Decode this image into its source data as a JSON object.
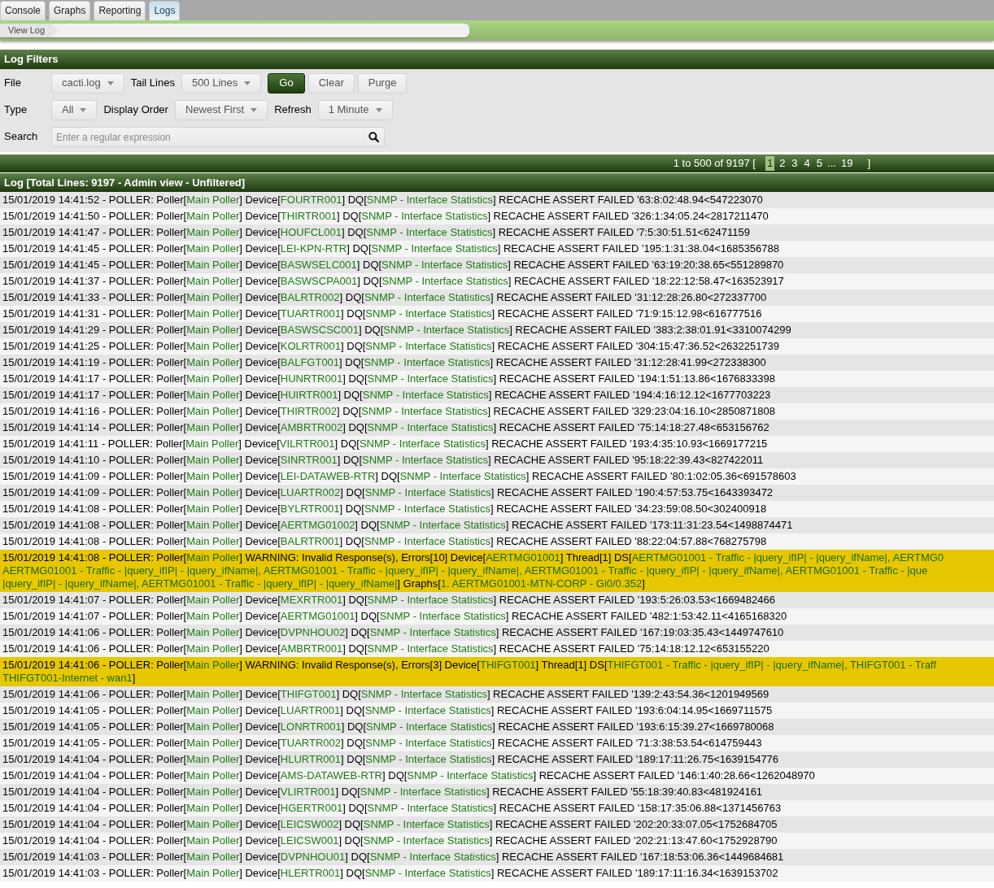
{
  "tabs": [
    {
      "label": "Console",
      "selected": false
    },
    {
      "label": "Graphs",
      "selected": false
    },
    {
      "label": "Reporting",
      "selected": false
    },
    {
      "label": "Logs",
      "selected": true
    }
  ],
  "breadcrumb": [
    "View Log"
  ],
  "filters": {
    "title": "Log Filters",
    "rows": [
      {
        "controls": [
          {
            "kind": "label",
            "text": "File"
          },
          {
            "kind": "select",
            "value": "cacti.log"
          },
          {
            "kind": "label",
            "text": "Tail Lines"
          },
          {
            "kind": "select",
            "value": "500 Lines"
          },
          {
            "kind": "primary_button",
            "text": "Go"
          },
          {
            "kind": "button",
            "text": "Clear"
          },
          {
            "kind": "button",
            "text": "Purge"
          }
        ]
      },
      {
        "controls": [
          {
            "kind": "label",
            "text": "Type"
          },
          {
            "kind": "select",
            "value": "All"
          },
          {
            "kind": "label",
            "text": "Display Order"
          },
          {
            "kind": "select",
            "value": "Newest First"
          },
          {
            "kind": "label",
            "text": "Refresh"
          },
          {
            "kind": "select",
            "value": "1 Minute"
          }
        ]
      },
      {
        "controls": [
          {
            "kind": "label",
            "text": "Search"
          },
          {
            "kind": "search",
            "placeholder": "Enter a regular expression"
          }
        ]
      }
    ]
  },
  "pagination": {
    "summary": "1 to 500 of 9197 [",
    "pages": [
      {
        "label": "1",
        "selected": true
      },
      {
        "label": "2",
        "selected": false
      },
      {
        "label": "3",
        "selected": false
      },
      {
        "label": "4",
        "selected": false
      },
      {
        "label": "5",
        "selected": false
      }
    ],
    "ellipsis": "...",
    "last_pages": [
      {
        "label": "19",
        "selected": false
      }
    ],
    "closing": "]"
  },
  "log": {
    "title": "Log [Total Lines: 9197 - Admin view - Unfiltered]",
    "rows": [
      {
        "kind": "info",
        "lines": [
          [
            {
              "text": "15/01/2019 14:41:52 - POLLER: Poller[",
              "highlighted": false
            },
            {
              "text": "Main Poller",
              "highlighted": true
            },
            {
              "text": "] Device[",
              "highlighted": false
            },
            {
              "text": "FOURTR001",
              "highlighted": true
            },
            {
              "text": "] DQ[",
              "highlighted": false
            },
            {
              "text": "SNMP - Interface Statistics",
              "highlighted": true
            },
            {
              "text": "] RECACHE ASSERT FAILED '63:8:02:48.94<547223070",
              "highlighted": false
            }
          ]
        ]
      },
      {
        "kind": "info",
        "lines": [
          [
            {
              "text": "15/01/2019 14:41:50 - POLLER: Poller[",
              "highlighted": false
            },
            {
              "text": "Main Poller",
              "highlighted": true
            },
            {
              "text": "] Device[",
              "highlighted": false
            },
            {
              "text": "THIRTR001",
              "highlighted": true
            },
            {
              "text": "] DQ[",
              "highlighted": false
            },
            {
              "text": "SNMP - Interface Statistics",
              "highlighted": true
            },
            {
              "text": "] RECACHE ASSERT FAILED '326:1:34:05.24<2817211470",
              "highlighted": false
            }
          ]
        ]
      },
      {
        "kind": "info",
        "lines": [
          [
            {
              "text": "15/01/2019 14:41:47 - POLLER: Poller[",
              "highlighted": false
            },
            {
              "text": "Main Poller",
              "highlighted": true
            },
            {
              "text": "] Device[",
              "highlighted": false
            },
            {
              "text": "HOUFCL001",
              "highlighted": true
            },
            {
              "text": "] DQ[",
              "highlighted": false
            },
            {
              "text": "SNMP - Interface Statistics",
              "highlighted": true
            },
            {
              "text": "] RECACHE ASSERT FAILED '7:5:30:51.51<62471159",
              "highlighted": false
            }
          ]
        ]
      },
      {
        "kind": "info",
        "lines": [
          [
            {
              "text": "15/01/2019 14:41:45 - POLLER: Poller[",
              "highlighted": false
            },
            {
              "text": "Main Poller",
              "highlighted": true
            },
            {
              "text": "] Device[",
              "highlighted": false
            },
            {
              "text": "LEI-KPN-RTR",
              "highlighted": true
            },
            {
              "text": "] DQ[",
              "highlighted": false
            },
            {
              "text": "SNMP - Interface Statistics",
              "highlighted": true
            },
            {
              "text": "] RECACHE ASSERT FAILED '195:1:31:38.04<1685356788",
              "highlighted": false
            }
          ]
        ]
      },
      {
        "kind": "info",
        "lines": [
          [
            {
              "text": "15/01/2019 14:41:45 - POLLER: Poller[",
              "highlighted": false
            },
            {
              "text": "Main Poller",
              "highlighted": true
            },
            {
              "text": "] Device[",
              "highlighted": false
            },
            {
              "text": "BASWSELC001",
              "highlighted": true
            },
            {
              "text": "] DQ[",
              "highlighted": false
            },
            {
              "text": "SNMP - Interface Statistics",
              "highlighted": true
            },
            {
              "text": "] RECACHE ASSERT FAILED '63:19:20:38.65<551289870",
              "highlighted": false
            }
          ]
        ]
      },
      {
        "kind": "info",
        "lines": [
          [
            {
              "text": "15/01/2019 14:41:37 - POLLER: Poller[",
              "highlighted": false
            },
            {
              "text": "Main Poller",
              "highlighted": true
            },
            {
              "text": "] Device[",
              "highlighted": false
            },
            {
              "text": "BASWSCPA001",
              "highlighted": true
            },
            {
              "text": "] DQ[",
              "highlighted": false
            },
            {
              "text": "SNMP - Interface Statistics",
              "highlighted": true
            },
            {
              "text": "] RECACHE ASSERT FAILED '18:22:12:58.47<163523917",
              "highlighted": false
            }
          ]
        ]
      },
      {
        "kind": "info",
        "lines": [
          [
            {
              "text": "15/01/2019 14:41:33 - POLLER: Poller[",
              "highlighted": false
            },
            {
              "text": "Main Poller",
              "highlighted": true
            },
            {
              "text": "] Device[",
              "highlighted": false
            },
            {
              "text": "BALRTR002",
              "highlighted": true
            },
            {
              "text": "] DQ[",
              "highlighted": false
            },
            {
              "text": "SNMP - Interface Statistics",
              "highlighted": true
            },
            {
              "text": "] RECACHE ASSERT FAILED '31:12:28:26.80<272337700",
              "highlighted": false
            }
          ]
        ]
      },
      {
        "kind": "info",
        "lines": [
          [
            {
              "text": "15/01/2019 14:41:31 - POLLER: Poller[",
              "highlighted": false
            },
            {
              "text": "Main Poller",
              "highlighted": true
            },
            {
              "text": "] Device[",
              "highlighted": false
            },
            {
              "text": "TUARTR001",
              "highlighted": true
            },
            {
              "text": "] DQ[",
              "highlighted": false
            },
            {
              "text": "SNMP - Interface Statistics",
              "highlighted": true
            },
            {
              "text": "] RECACHE ASSERT FAILED '71:9:15:12.98<616777516",
              "highlighted": false
            }
          ]
        ]
      },
      {
        "kind": "info",
        "lines": [
          [
            {
              "text": "15/01/2019 14:41:29 - POLLER: Poller[",
              "highlighted": false
            },
            {
              "text": "Main Poller",
              "highlighted": true
            },
            {
              "text": "] Device[",
              "highlighted": false
            },
            {
              "text": "BASWSCSC001",
              "highlighted": true
            },
            {
              "text": "] DQ[",
              "highlighted": false
            },
            {
              "text": "SNMP - Interface Statistics",
              "highlighted": true
            },
            {
              "text": "] RECACHE ASSERT FAILED '383:2:38:01.91<3310074299",
              "highlighted": false
            }
          ]
        ]
      },
      {
        "kind": "info",
        "lines": [
          [
            {
              "text": "15/01/2019 14:41:25 - POLLER: Poller[",
              "highlighted": false
            },
            {
              "text": "Main Poller",
              "highlighted": true
            },
            {
              "text": "] Device[",
              "highlighted": false
            },
            {
              "text": "KOLRTR001",
              "highlighted": true
            },
            {
              "text": "] DQ[",
              "highlighted": false
            },
            {
              "text": "SNMP - Interface Statistics",
              "highlighted": true
            },
            {
              "text": "] RECACHE ASSERT FAILED '304:15:47:36.52<2632251739",
              "highlighted": false
            }
          ]
        ]
      },
      {
        "kind": "info",
        "lines": [
          [
            {
              "text": "15/01/2019 14:41:19 - POLLER: Poller[",
              "highlighted": false
            },
            {
              "text": "Main Poller",
              "highlighted": true
            },
            {
              "text": "] Device[",
              "highlighted": false
            },
            {
              "text": "BALFGT001",
              "highlighted": true
            },
            {
              "text": "] DQ[",
              "highlighted": false
            },
            {
              "text": "SNMP - Interface Statistics",
              "highlighted": true
            },
            {
              "text": "] RECACHE ASSERT FAILED '31:12:28:41.99<272338300",
              "highlighted": false
            }
          ]
        ]
      },
      {
        "kind": "info",
        "lines": [
          [
            {
              "text": "15/01/2019 14:41:17 - POLLER: Poller[",
              "highlighted": false
            },
            {
              "text": "Main Poller",
              "highlighted": true
            },
            {
              "text": "] Device[",
              "highlighted": false
            },
            {
              "text": "HUNRTR001",
              "highlighted": true
            },
            {
              "text": "] DQ[",
              "highlighted": false
            },
            {
              "text": "SNMP - Interface Statistics",
              "highlighted": true
            },
            {
              "text": "] RECACHE ASSERT FAILED '194:1:51:13.86<1676833398",
              "highlighted": false
            }
          ]
        ]
      },
      {
        "kind": "info",
        "lines": [
          [
            {
              "text": "15/01/2019 14:41:17 - POLLER: Poller[",
              "highlighted": false
            },
            {
              "text": "Main Poller",
              "highlighted": true
            },
            {
              "text": "] Device[",
              "highlighted": false
            },
            {
              "text": "HUIRTR001",
              "highlighted": true
            },
            {
              "text": "] DQ[",
              "highlighted": false
            },
            {
              "text": "SNMP - Interface Statistics",
              "highlighted": true
            },
            {
              "text": "] RECACHE ASSERT FAILED '194:4:16:12.12<1677703223",
              "highlighted": false
            }
          ]
        ]
      },
      {
        "kind": "info",
        "lines": [
          [
            {
              "text": "15/01/2019 14:41:16 - POLLER: Poller[",
              "highlighted": false
            },
            {
              "text": "Main Poller",
              "highlighted": true
            },
            {
              "text": "] Device[",
              "highlighted": false
            },
            {
              "text": "THIRTR002",
              "highlighted": true
            },
            {
              "text": "] DQ[",
              "highlighted": false
            },
            {
              "text": "SNMP - Interface Statistics",
              "highlighted": true
            },
            {
              "text": "] RECACHE ASSERT FAILED '329:23:04:16.10<2850871808",
              "highlighted": false
            }
          ]
        ]
      },
      {
        "kind": "info",
        "lines": [
          [
            {
              "text": "15/01/2019 14:41:14 - POLLER: Poller[",
              "highlighted": false
            },
            {
              "text": "Main Poller",
              "highlighted": true
            },
            {
              "text": "] Device[",
              "highlighted": false
            },
            {
              "text": "AMBRTR002",
              "highlighted": true
            },
            {
              "text": "] DQ[",
              "highlighted": false
            },
            {
              "text": "SNMP - Interface Statistics",
              "highlighted": true
            },
            {
              "text": "] RECACHE ASSERT FAILED '75:14:18:27.48<653156762",
              "highlighted": false
            }
          ]
        ]
      },
      {
        "kind": "info",
        "lines": [
          [
            {
              "text": "15/01/2019 14:41:11 - POLLER: Poller[",
              "highlighted": false
            },
            {
              "text": "Main Poller",
              "highlighted": true
            },
            {
              "text": "] Device[",
              "highlighted": false
            },
            {
              "text": "VILRTR001",
              "highlighted": true
            },
            {
              "text": "] DQ[",
              "highlighted": false
            },
            {
              "text": "SNMP - Interface Statistics",
              "highlighted": true
            },
            {
              "text": "] RECACHE ASSERT FAILED '193:4:35:10.93<1669177215",
              "highlighted": false
            }
          ]
        ]
      },
      {
        "kind": "info",
        "lines": [
          [
            {
              "text": "15/01/2019 14:41:10 - POLLER: Poller[",
              "highlighted": false
            },
            {
              "text": "Main Poller",
              "highlighted": true
            },
            {
              "text": "] Device[",
              "highlighted": false
            },
            {
              "text": "SINRTR001",
              "highlighted": true
            },
            {
              "text": "] DQ[",
              "highlighted": false
            },
            {
              "text": "SNMP - Interface Statistics",
              "highlighted": true
            },
            {
              "text": "] RECACHE ASSERT FAILED '95:18:22:39.43<827422011",
              "highlighted": false
            }
          ]
        ]
      },
      {
        "kind": "info",
        "lines": [
          [
            {
              "text": "15/01/2019 14:41:09 - POLLER: Poller[",
              "highlighted": false
            },
            {
              "text": "Main Poller",
              "highlighted": true
            },
            {
              "text": "] Device[",
              "highlighted": false
            },
            {
              "text": "LEI-DATAWEB-RTR",
              "highlighted": true
            },
            {
              "text": "] DQ[",
              "highlighted": false
            },
            {
              "text": "SNMP - Interface Statistics",
              "highlighted": true
            },
            {
              "text": "] RECACHE ASSERT FAILED '80:1:02:05.36<691578603",
              "highlighted": false
            }
          ]
        ]
      },
      {
        "kind": "info",
        "lines": [
          [
            {
              "text": "15/01/2019 14:41:09 - POLLER: Poller[",
              "highlighted": false
            },
            {
              "text": "Main Poller",
              "highlighted": true
            },
            {
              "text": "] Device[",
              "highlighted": false
            },
            {
              "text": "LUARTR002",
              "highlighted": true
            },
            {
              "text": "] DQ[",
              "highlighted": false
            },
            {
              "text": "SNMP - Interface Statistics",
              "highlighted": true
            },
            {
              "text": "] RECACHE ASSERT FAILED '190:4:57:53.75<1643393472",
              "highlighted": false
            }
          ]
        ]
      },
      {
        "kind": "info",
        "lines": [
          [
            {
              "text": "15/01/2019 14:41:08 - POLLER: Poller[",
              "highlighted": false
            },
            {
              "text": "Main Poller",
              "highlighted": true
            },
            {
              "text": "] Device[",
              "highlighted": false
            },
            {
              "text": "BYLRTR001",
              "highlighted": true
            },
            {
              "text": "] DQ[",
              "highlighted": false
            },
            {
              "text": "SNMP - Interface Statistics",
              "highlighted": true
            },
            {
              "text": "] RECACHE ASSERT FAILED '34:23:59:08.50<302400918",
              "highlighted": false
            }
          ]
        ]
      },
      {
        "kind": "info",
        "lines": [
          [
            {
              "text": "15/01/2019 14:41:08 - POLLER: Poller[",
              "highlighted": false
            },
            {
              "text": "Main Poller",
              "highlighted": true
            },
            {
              "text": "] Device[",
              "highlighted": false
            },
            {
              "text": "AERTMG01002",
              "highlighted": true
            },
            {
              "text": "] DQ[",
              "highlighted": false
            },
            {
              "text": "SNMP - Interface Statistics",
              "highlighted": true
            },
            {
              "text": "] RECACHE ASSERT FAILED '173:11:31:23.54<1498874471",
              "highlighted": false
            }
          ]
        ]
      },
      {
        "kind": "info",
        "lines": [
          [
            {
              "text": "15/01/2019 14:41:08 - POLLER: Poller[",
              "highlighted": false
            },
            {
              "text": "Main Poller",
              "highlighted": true
            },
            {
              "text": "] Device[",
              "highlighted": false
            },
            {
              "text": "BALRTR001",
              "highlighted": true
            },
            {
              "text": "] DQ[",
              "highlighted": false
            },
            {
              "text": "SNMP - Interface Statistics",
              "highlighted": true
            },
            {
              "text": "] RECACHE ASSERT FAILED '88:22:04:57.88<768275798",
              "highlighted": false
            }
          ]
        ]
      },
      {
        "kind": "warning",
        "lines": [
          [
            {
              "text": "15/01/2019 14:41:08 - POLLER: Poller[",
              "highlighted": false
            },
            {
              "text": "Main Poller",
              "highlighted": true
            },
            {
              "text": "] WARNING: Invalid Response(s), Errors[10] Device[",
              "highlighted": false
            },
            {
              "text": "AERTMG01001",
              "highlighted": true
            },
            {
              "text": "] Thread[1] DS[",
              "highlighted": false
            },
            {
              "text": "AERTMG01001 - Traffic - |query_ifIP| - |query_ifName|, AERTMG0",
              "highlighted": true
            }
          ],
          [
            {
              "text": "AERTMG01001 - Traffic - |query_ifIP| - |query_ifName|, AERTMG01001 - Traffic - |query_ifIP| - |query_ifName|, AERTMG01001 - Traffic - |query_ifIP| - |query_ifName|, AERTMG01001 - Traffic - |que",
              "highlighted": true
            }
          ],
          [
            {
              "text": "|query_ifIP| - |query_ifName|, AERTMG01001 - Traffic - |query_ifIP| - |query_ifName|",
              "highlighted": true
            },
            {
              "text": "] Graphs[",
              "highlighted": false
            },
            {
              "text": "1. AERTMG01001-MTN-CORP - Gi0/0.352",
              "highlighted": true
            },
            {
              "text": "]",
              "highlighted": false
            }
          ]
        ]
      },
      {
        "kind": "info",
        "lines": [
          [
            {
              "text": "15/01/2019 14:41:07 - POLLER: Poller[",
              "highlighted": false
            },
            {
              "text": "Main Poller",
              "highlighted": true
            },
            {
              "text": "] Device[",
              "highlighted": false
            },
            {
              "text": "MEXRTR001",
              "highlighted": true
            },
            {
              "text": "] DQ[",
              "highlighted": false
            },
            {
              "text": "SNMP - Interface Statistics",
              "highlighted": true
            },
            {
              "text": "] RECACHE ASSERT FAILED '193:5:26:03.53<1669482466",
              "highlighted": false
            }
          ]
        ]
      },
      {
        "kind": "info",
        "lines": [
          [
            {
              "text": "15/01/2019 14:41:07 - POLLER: Poller[",
              "highlighted": false
            },
            {
              "text": "Main Poller",
              "highlighted": true
            },
            {
              "text": "] Device[",
              "highlighted": false
            },
            {
              "text": "AERTMG01001",
              "highlighted": true
            },
            {
              "text": "] DQ[",
              "highlighted": false
            },
            {
              "text": "SNMP - Interface Statistics",
              "highlighted": true
            },
            {
              "text": "] RECACHE ASSERT FAILED '482:1:53:42.11<4165168320",
              "highlighted": false
            }
          ]
        ]
      },
      {
        "kind": "info",
        "lines": [
          [
            {
              "text": "15/01/2019 14:41:06 - POLLER: Poller[",
              "highlighted": false
            },
            {
              "text": "Main Poller",
              "highlighted": true
            },
            {
              "text": "] Device[",
              "highlighted": false
            },
            {
              "text": "DVPNHOU02",
              "highlighted": true
            },
            {
              "text": "] DQ[",
              "highlighted": false
            },
            {
              "text": "SNMP - Interface Statistics",
              "highlighted": true
            },
            {
              "text": "] RECACHE ASSERT FAILED '167:19:03:35.43<1449747610",
              "highlighted": false
            }
          ]
        ]
      },
      {
        "kind": "info",
        "lines": [
          [
            {
              "text": "15/01/2019 14:41:06 - POLLER: Poller[",
              "highlighted": false
            },
            {
              "text": "Main Poller",
              "highlighted": true
            },
            {
              "text": "] Device[",
              "highlighted": false
            },
            {
              "text": "AMBRTR001",
              "highlighted": true
            },
            {
              "text": "] DQ[",
              "highlighted": false
            },
            {
              "text": "SNMP - Interface Statistics",
              "highlighted": true
            },
            {
              "text": "] RECACHE ASSERT FAILED '75:14:18:12.12<653155220",
              "highlighted": false
            }
          ]
        ]
      },
      {
        "kind": "warning",
        "lines": [
          [
            {
              "text": "15/01/2019 14:41:06 - POLLER: Poller[",
              "highlighted": false
            },
            {
              "text": "Main Poller",
              "highlighted": true
            },
            {
              "text": "] WARNING: Invalid Response(s), Errors[3] Device[",
              "highlighted": false
            },
            {
              "text": "THIFGT001",
              "highlighted": true
            },
            {
              "text": "] Thread[1] DS[",
              "highlighted": false
            },
            {
              "text": "THIFGT001 - Traffic - |query_ifIP| - |query_ifName|, THIFGT001 - Traff",
              "highlighted": true
            }
          ],
          [
            {
              "text": "THIFGT001-Internet - wan1",
              "highlighted": true
            },
            {
              "text": "]",
              "highlighted": false
            }
          ]
        ]
      },
      {
        "kind": "info",
        "lines": [
          [
            {
              "text": "15/01/2019 14:41:06 - POLLER: Poller[",
              "highlighted": false
            },
            {
              "text": "Main Poller",
              "highlighted": true
            },
            {
              "text": "] Device[",
              "highlighted": false
            },
            {
              "text": "THIFGT001",
              "highlighted": true
            },
            {
              "text": "] DQ[",
              "highlighted": false
            },
            {
              "text": "SNMP - Interface Statistics",
              "highlighted": true
            },
            {
              "text": "] RECACHE ASSERT FAILED '139:2:43:54.36<1201949569",
              "highlighted": false
            }
          ]
        ]
      },
      {
        "kind": "info",
        "lines": [
          [
            {
              "text": "15/01/2019 14:41:05 - POLLER: Poller[",
              "highlighted": false
            },
            {
              "text": "Main Poller",
              "highlighted": true
            },
            {
              "text": "] Device[",
              "highlighted": false
            },
            {
              "text": "LUARTR001",
              "highlighted": true
            },
            {
              "text": "] DQ[",
              "highlighted": false
            },
            {
              "text": "SNMP - Interface Statistics",
              "highlighted": true
            },
            {
              "text": "] RECACHE ASSERT FAILED '193:6:04:14.95<1669711575",
              "highlighted": false
            }
          ]
        ]
      },
      {
        "kind": "info",
        "lines": [
          [
            {
              "text": "15/01/2019 14:41:05 - POLLER: Poller[",
              "highlighted": false
            },
            {
              "text": "Main Poller",
              "highlighted": true
            },
            {
              "text": "] Device[",
              "highlighted": false
            },
            {
              "text": "LONRTR001",
              "highlighted": true
            },
            {
              "text": "] DQ[",
              "highlighted": false
            },
            {
              "text": "SNMP - Interface Statistics",
              "highlighted": true
            },
            {
              "text": "] RECACHE ASSERT FAILED '193:6:15:39.27<1669780068",
              "highlighted": false
            }
          ]
        ]
      },
      {
        "kind": "info",
        "lines": [
          [
            {
              "text": "15/01/2019 14:41:05 - POLLER: Poller[",
              "highlighted": false
            },
            {
              "text": "Main Poller",
              "highlighted": true
            },
            {
              "text": "] Device[",
              "highlighted": false
            },
            {
              "text": "TUARTR002",
              "highlighted": true
            },
            {
              "text": "] DQ[",
              "highlighted": false
            },
            {
              "text": "SNMP - Interface Statistics",
              "highlighted": true
            },
            {
              "text": "] RECACHE ASSERT FAILED '71:3:38:53.54<614759443",
              "highlighted": false
            }
          ]
        ]
      },
      {
        "kind": "info",
        "lines": [
          [
            {
              "text": "15/01/2019 14:41:04 - POLLER: Poller[",
              "highlighted": false
            },
            {
              "text": "Main Poller",
              "highlighted": true
            },
            {
              "text": "] Device[",
              "highlighted": false
            },
            {
              "text": "HLURTR001",
              "highlighted": true
            },
            {
              "text": "] DQ[",
              "highlighted": false
            },
            {
              "text": "SNMP - Interface Statistics",
              "highlighted": true
            },
            {
              "text": "] RECACHE ASSERT FAILED '189:17:11:26.75<1639154776",
              "highlighted": false
            }
          ]
        ]
      },
      {
        "kind": "info",
        "lines": [
          [
            {
              "text": "15/01/2019 14:41:04 - POLLER: Poller[",
              "highlighted": false
            },
            {
              "text": "Main Poller",
              "highlighted": true
            },
            {
              "text": "] Device[",
              "highlighted": false
            },
            {
              "text": "AMS-DATAWEB-RTR",
              "highlighted": true
            },
            {
              "text": "] DQ[",
              "highlighted": false
            },
            {
              "text": "SNMP - Interface Statistics",
              "highlighted": true
            },
            {
              "text": "] RECACHE ASSERT FAILED '146:1:40:28.66<1262048970",
              "highlighted": false
            }
          ]
        ]
      },
      {
        "kind": "info",
        "lines": [
          [
            {
              "text": "15/01/2019 14:41:04 - POLLER: Poller[",
              "highlighted": false
            },
            {
              "text": "Main Poller",
              "highlighted": true
            },
            {
              "text": "] Device[",
              "highlighted": false
            },
            {
              "text": "VLIRTR001",
              "highlighted": true
            },
            {
              "text": "] DQ[",
              "highlighted": false
            },
            {
              "text": "SNMP - Interface Statistics",
              "highlighted": true
            },
            {
              "text": "] RECACHE ASSERT FAILED '55:18:39:40.83<481924161",
              "highlighted": false
            }
          ]
        ]
      },
      {
        "kind": "info",
        "lines": [
          [
            {
              "text": "15/01/2019 14:41:04 - POLLER: Poller[",
              "highlighted": false
            },
            {
              "text": "Main Poller",
              "highlighted": true
            },
            {
              "text": "] Device[",
              "highlighted": false
            },
            {
              "text": "HGERTR001",
              "highlighted": true
            },
            {
              "text": "] DQ[",
              "highlighted": false
            },
            {
              "text": "SNMP - Interface Statistics",
              "highlighted": true
            },
            {
              "text": "] RECACHE ASSERT FAILED '158:17:35:06.88<1371456763",
              "highlighted": false
            }
          ]
        ]
      },
      {
        "kind": "info",
        "lines": [
          [
            {
              "text": "15/01/2019 14:41:04 - POLLER: Poller[",
              "highlighted": false
            },
            {
              "text": "Main Poller",
              "highlighted": true
            },
            {
              "text": "] Device[",
              "highlighted": false
            },
            {
              "text": "LEICSW002",
              "highlighted": true
            },
            {
              "text": "] DQ[",
              "highlighted": false
            },
            {
              "text": "SNMP - Interface Statistics",
              "highlighted": true
            },
            {
              "text": "] RECACHE ASSERT FAILED '202:20:33:07.05<1752684705",
              "highlighted": false
            }
          ]
        ]
      },
      {
        "kind": "info",
        "lines": [
          [
            {
              "text": "15/01/2019 14:41:04 - POLLER: Poller[",
              "highlighted": false
            },
            {
              "text": "Main Poller",
              "highlighted": true
            },
            {
              "text": "] Device[",
              "highlighted": false
            },
            {
              "text": "LEICSW001",
              "highlighted": true
            },
            {
              "text": "] DQ[",
              "highlighted": false
            },
            {
              "text": "SNMP - Interface Statistics",
              "highlighted": true
            },
            {
              "text": "] RECACHE ASSERT FAILED '202:21:13:47.60<1752928790",
              "highlighted": false
            }
          ]
        ]
      },
      {
        "kind": "info",
        "lines": [
          [
            {
              "text": "15/01/2019 14:41:03 - POLLER: Poller[",
              "highlighted": false
            },
            {
              "text": "Main Poller",
              "highlighted": true
            },
            {
              "text": "] Device[",
              "highlighted": false
            },
            {
              "text": "DVPNHOU01",
              "highlighted": true
            },
            {
              "text": "] DQ[",
              "highlighted": false
            },
            {
              "text": "SNMP - Interface Statistics",
              "highlighted": true
            },
            {
              "text": "] RECACHE ASSERT FAILED '167:18:53:06.36<1449684681",
              "highlighted": false
            }
          ]
        ]
      },
      {
        "kind": "info",
        "lines": [
          [
            {
              "text": "15/01/2019 14:41:03 - POLLER: Poller[",
              "highlighted": false
            },
            {
              "text": "Main Poller",
              "highlighted": true
            },
            {
              "text": "] Device[",
              "highlighted": false
            },
            {
              "text": "HLERTR001",
              "highlighted": true
            },
            {
              "text": "] DQ[",
              "highlighted": false
            },
            {
              "text": "SNMP - Interface Statistics",
              "highlighted": true
            },
            {
              "text": "] RECACHE ASSERT FAILED '189:17:11:16.34<1639153702",
              "highlighted": false
            }
          ]
        ]
      }
    ]
  }
}
